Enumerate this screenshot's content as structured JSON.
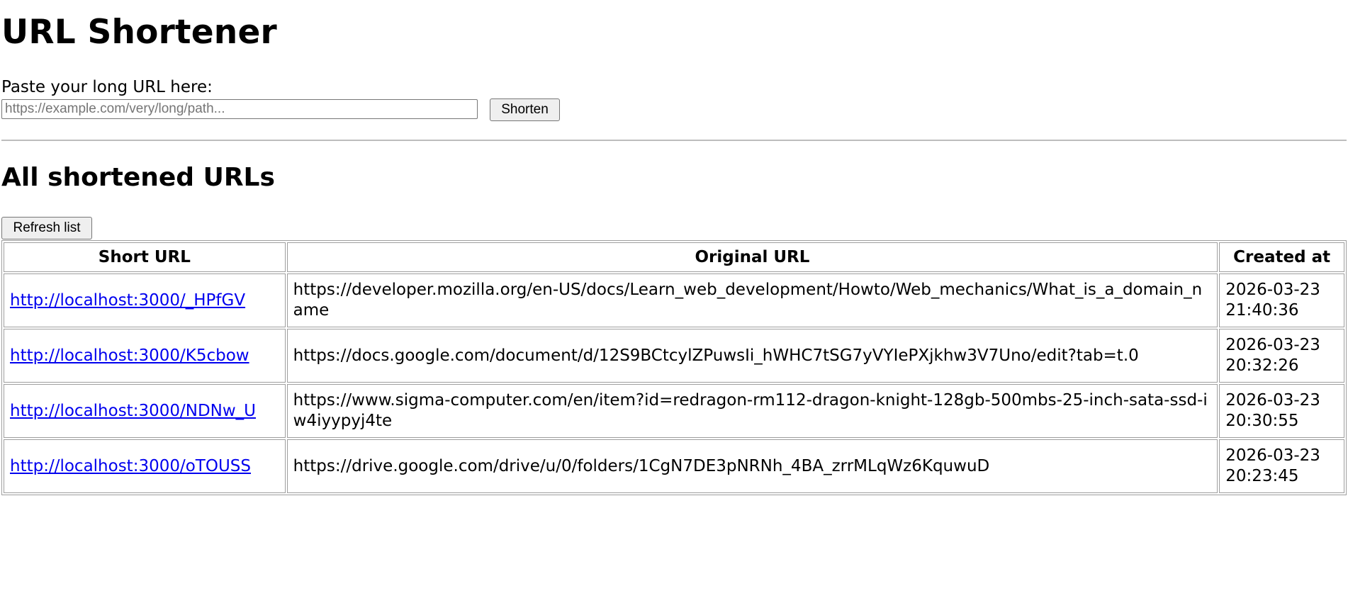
{
  "page": {
    "title": "URL Shortener",
    "form": {
      "label": "Paste your long URL here:",
      "input_placeholder": "https://example.com/very/long/path...",
      "input_value": "",
      "shorten_label": "Shorten"
    },
    "list": {
      "title": "All shortened URLs",
      "refresh_label": "Refresh list",
      "columns": [
        "Short URL",
        "Original URL",
        "Created at"
      ],
      "rows": [
        {
          "short_url": "http://localhost:3000/_HPfGV",
          "original_url": "https://developer.mozilla.org/en-US/docs/Learn_web_development/Howto/Web_mechanics/What_is_a_domain_name",
          "created_at": "2026-03-23 21:40:36"
        },
        {
          "short_url": "http://localhost:3000/K5cbow",
          "original_url": "https://docs.google.com/document/d/12S9BCtcylZPuwsIi_hWHC7tSG7yVYIePXjkhw3V7Uno/edit?tab=t.0",
          "created_at": "2026-03-23 20:32:26"
        },
        {
          "short_url": "http://localhost:3000/NDNw_U",
          "original_url": "https://www.sigma-computer.com/en/item?id=redragon-rm112-dragon-knight-128gb-500mbs-25-inch-sata-ssd-iw4iyypyj4te",
          "created_at": "2026-03-23 20:30:55"
        },
        {
          "short_url": "http://localhost:3000/oTOUSS",
          "original_url": "https://drive.google.com/drive/u/0/folders/1CgN7DE3pNRNh_4BA_zrrMLqWz6KquwuD",
          "created_at": "2026-03-23 20:23:45"
        }
      ]
    }
  },
  "colors": {
    "link": "#0000ee",
    "button_bg": "#efefef",
    "divider": "#bdbdbd",
    "table_border": "#9e9e9e"
  }
}
